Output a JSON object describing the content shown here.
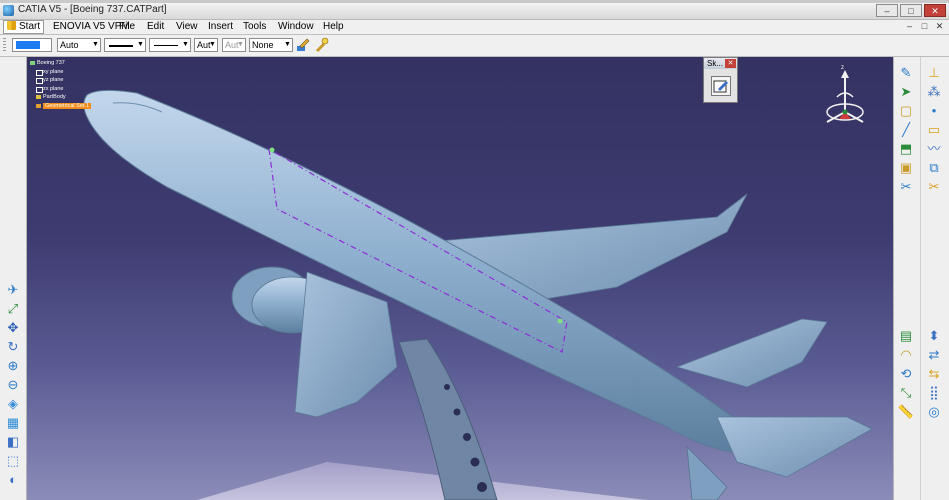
{
  "window": {
    "title": "CATIA V5 - [Boeing 737.CATPart]",
    "buttons": [
      "–",
      "□",
      "✕"
    ]
  },
  "menubar": {
    "items": [
      "Start",
      "ENOVIA V5 VPM",
      "File",
      "Edit",
      "View",
      "Insert",
      "Tools",
      "Window",
      "Help"
    ],
    "doc_buttons": [
      "–",
      "□",
      "✕"
    ]
  },
  "toolbar": {
    "color_value": "#1e7cf2",
    "transparency": "Auto",
    "thickness_value": "",
    "linetype_value": "",
    "point_type": "Aut",
    "layer_disabled": "Aut",
    "layer": "None",
    "icons": [
      "painter-icon",
      "apply-style-icon"
    ]
  },
  "spec_tree": {
    "items": [
      {
        "label": "Boeing 737",
        "level": 0,
        "selected": false
      },
      {
        "label": "xy plane",
        "level": 1,
        "selected": false
      },
      {
        "label": "yz plane",
        "level": 1,
        "selected": false
      },
      {
        "label": "zx plane",
        "level": 1,
        "selected": false
      },
      {
        "label": "PartBody",
        "level": 1,
        "selected": false
      },
      {
        "label": "Geometrical Set.1",
        "level": 1,
        "selected": true
      }
    ]
  },
  "sketcher_panel": {
    "title": "Sk...",
    "close": "✕",
    "button_icon": "sketch-icon"
  },
  "compass_axes": [
    "x",
    "y",
    "z"
  ],
  "colors": {
    "background_top": "#343262",
    "background_bottom": "#8b8cb8",
    "model": "#8fb0cf",
    "selection": "#f28c1c",
    "sketch_line": "#8d2cd6"
  },
  "left_toolbar_icons": [
    "fly-mode-icon",
    "fit-all-icon",
    "pan-icon",
    "rotate-icon",
    "zoom-in-icon",
    "zoom-out-icon",
    "normal-view-icon",
    "multi-view-icon",
    "iso-view-icon",
    "view-mode-icon",
    "hide-show-icon"
  ],
  "right_toolbar_icons": [
    "sketcher-icon",
    "axis-system-icon",
    "select-icon",
    "snap-icon",
    "wireframe-icon",
    "point-icon",
    "line-icon",
    "plane-icon",
    "extrude-icon",
    "sweep-icon",
    "fill-icon",
    "join-icon",
    "split-icon",
    "trim-icon",
    "boundary-icon",
    "extract-icon",
    "fillet-icon",
    "translate-icon",
    "rotate-surface-icon",
    "symmetry-icon",
    "scaling-icon",
    "pattern-icon",
    "measure-icon",
    "analysis-icon"
  ]
}
